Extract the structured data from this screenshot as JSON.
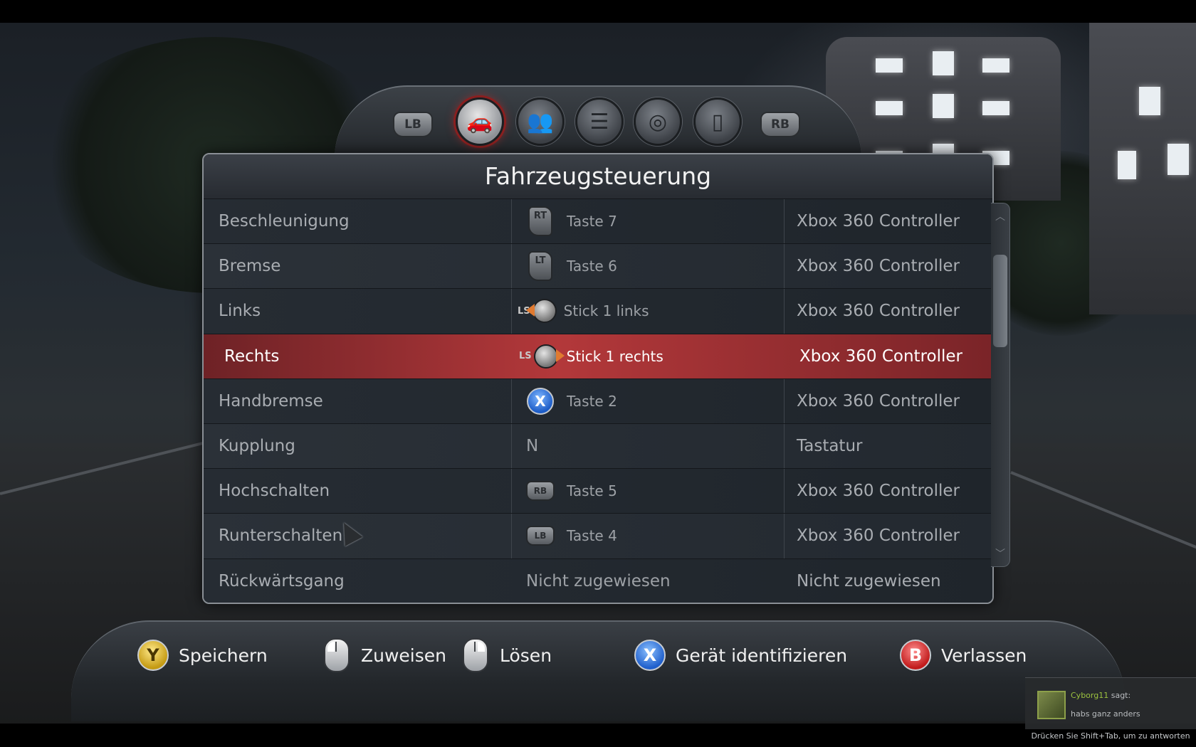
{
  "tabs": {
    "left_shoulder": "LB",
    "right_shoulder": "RB",
    "items": [
      {
        "icon": "car-icon",
        "active": true
      },
      {
        "icon": "players-icon",
        "active": false
      },
      {
        "icon": "settings-list-icon",
        "active": false
      },
      {
        "icon": "wheel-joystick-icon",
        "active": false
      },
      {
        "icon": "mouse-icon",
        "active": false
      }
    ]
  },
  "panel": {
    "title": "Fahrzeugsteuerung",
    "rows": [
      {
        "action": "Beschleunigung",
        "key_icon": "rt-trigger-icon",
        "key_icon_label": "RT",
        "key": "Taste 7",
        "device": "Xbox 360 Controller",
        "selected": false
      },
      {
        "action": "Bremse",
        "key_icon": "lt-trigger-icon",
        "key_icon_label": "LT",
        "key": "Taste 6",
        "device": "Xbox 360 Controller",
        "selected": false
      },
      {
        "action": "Links",
        "key_icon": "left-stick-left-icon",
        "key_icon_label": "LS",
        "key": "Stick 1 links",
        "device": "Xbox 360 Controller",
        "selected": false
      },
      {
        "action": "Rechts",
        "key_icon": "left-stick-right-icon",
        "key_icon_label": "LS",
        "key": "Stick 1 rechts",
        "device": "Xbox 360 Controller",
        "selected": true
      },
      {
        "action": "Handbremse",
        "key_icon": "x-button-icon",
        "key_icon_label": "X",
        "key": "Taste 2",
        "device": "Xbox 360 Controller",
        "selected": false
      },
      {
        "action": "Kupplung",
        "key_icon": "",
        "key_icon_label": "",
        "key": "N",
        "device": "Tastatur",
        "selected": false
      },
      {
        "action": "Hochschalten",
        "key_icon": "rb-bumper-icon",
        "key_icon_label": "RB",
        "key": "Taste 5",
        "device": "Xbox 360 Controller",
        "selected": false
      },
      {
        "action": "Runterschalten",
        "key_icon": "lb-bumper-icon",
        "key_icon_label": "LB",
        "key": "Taste 4",
        "device": "Xbox 360 Controller",
        "selected": false
      },
      {
        "action": "Rückwärtsgang",
        "key_icon": "",
        "key_icon_label": "",
        "key": "Nicht zugewiesen",
        "device": "Nicht zugewiesen",
        "selected": false
      }
    ]
  },
  "prompts": {
    "save": {
      "button": "Y",
      "label": "Speichern"
    },
    "assign": {
      "button": "left-mouse-icon",
      "label": "Zuweisen"
    },
    "release": {
      "button": "right-mouse-icon",
      "label": "Lösen"
    },
    "identify": {
      "button": "X",
      "label": "Gerät identifizieren"
    },
    "exit": {
      "button": "B",
      "label": "Verlassen"
    }
  },
  "chat": {
    "user": "Cyborg11",
    "says": "sagt:",
    "message": "habs ganz anders",
    "hint": "Drücken Sie Shift+Tab, um zu antworten"
  },
  "colors": {
    "selected_row": "#b3383a",
    "accent_orange": "#e07a30",
    "chat_name": "#9cc33f"
  }
}
